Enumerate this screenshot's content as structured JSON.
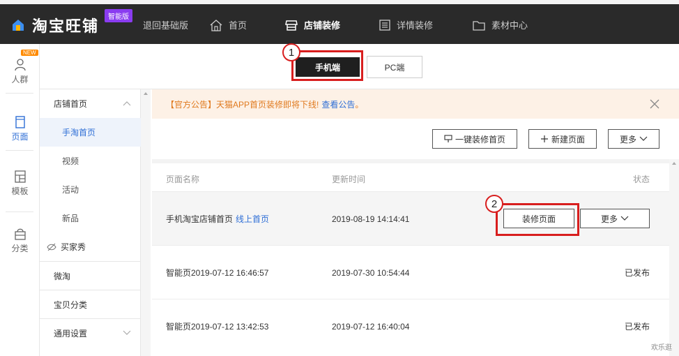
{
  "app": {
    "brand": "淘宝旺铺",
    "edition_badge": "智能版"
  },
  "topnav": {
    "back_basic": "退回基础版",
    "home": "首页",
    "shop_decor": "店铺装修",
    "detail_decor": "详情装修",
    "material_center": "素材中心"
  },
  "leftrail": {
    "new_badge": "NEW",
    "items": [
      {
        "label": "人群",
        "icon": "person-icon"
      },
      {
        "label": "页面",
        "icon": "page-icon"
      },
      {
        "label": "模板",
        "icon": "template-icon"
      },
      {
        "label": "分类",
        "icon": "category-icon"
      }
    ]
  },
  "device_tabs": {
    "mobile": "手机端",
    "pc": "PC端"
  },
  "annotations": {
    "step1": "1",
    "step2": "2"
  },
  "sidenav": {
    "items": [
      {
        "label": "店铺首页"
      },
      {
        "label": "手淘首页"
      },
      {
        "label": "视频"
      },
      {
        "label": "活动"
      },
      {
        "label": "新品"
      },
      {
        "label": "买家秀"
      },
      {
        "label": "微淘"
      },
      {
        "label": "宝贝分类"
      },
      {
        "label": "通用设置"
      }
    ]
  },
  "notice": {
    "text": "【官方公告】天猫APP首页装修即将下线!",
    "link": "查看公告",
    "suffix": "。"
  },
  "actions": {
    "one_click": "一键装修首页",
    "new_page": "新建页面",
    "more": "更多"
  },
  "table": {
    "headers": [
      "页面名称",
      "更新时间",
      "状态"
    ],
    "rows": [
      {
        "name": "手机淘宝店铺首页",
        "tag": "线上首页",
        "time": "2019-08-19 14:14:41",
        "decorate_btn": "装修页面",
        "more_btn": "更多"
      },
      {
        "name": "智能页2019-07-12 16:46:57",
        "time": "2019-07-30 10:54:44",
        "status": "已发布"
      },
      {
        "name": "智能页2019-07-12 13:42:53",
        "time": "2019-07-12 16:40:04",
        "status": "已发布"
      }
    ]
  },
  "watermark": "欢乐逛",
  "colors": {
    "topbar": "#2a2a2a",
    "accent_blue": "#2f6fd6",
    "highlight_red": "#d81e1e",
    "notice_bg": "#fdf1e6",
    "notice_text": "#e07a1f"
  }
}
